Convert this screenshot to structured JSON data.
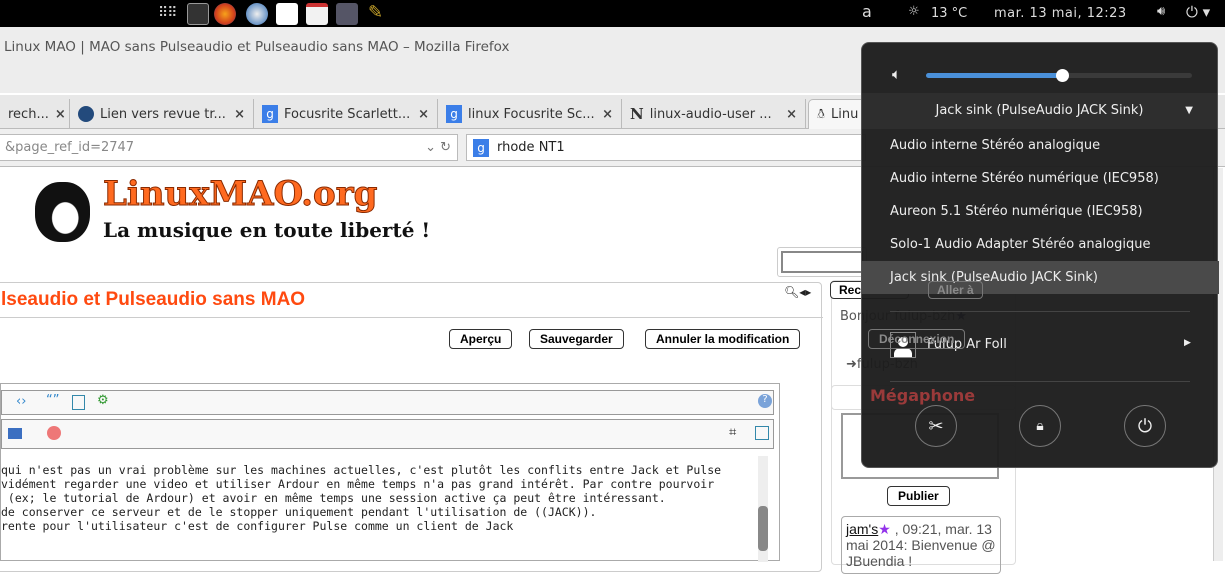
{
  "topbar": {
    "weather": "13 °C",
    "clock": "mar. 13 mai, 12:23",
    "accessibility_glyph": "a"
  },
  "window": {
    "title": "Linux MAO | MAO sans Pulseaudio et Pulseaudio sans MAO – Mozilla Firefox"
  },
  "tabs": [
    {
      "label": "rech...",
      "icon": "tab-icon"
    },
    {
      "label": "Lien vers revue tr...",
      "icon": "wave-icon"
    },
    {
      "label": "Focusrite Scarlett...",
      "icon": "google-icon"
    },
    {
      "label": "linux Focusrite Sc...",
      "icon": "google-icon"
    },
    {
      "label": "linux-audio-user ...",
      "icon": "n-icon"
    },
    {
      "label": "Linu",
      "icon": "tux-icon"
    }
  ],
  "tab_close": "×",
  "navbar": {
    "url": "&page_ref_id=2747",
    "search": "rhode NT1",
    "google_glyph": "g"
  },
  "site": {
    "logo_title": "LinuxMAO.org",
    "logo_tagline": "La musique en toute liberté !",
    "page_heading": "lseaudio et Pulseaudio sans MAO",
    "buttons": {
      "preview": "Aperçu",
      "save": "Sauvegarder",
      "cancel": "Annuler la modification"
    },
    "editor_lines": [
      "qui n'est pas un vrai problème sur les machines actuelles, c'est plutôt les conflits entre Jack et Pulse",
      "vidément regarder une video et utiliser Ardour en même temps n'a pas grand intérêt. Par contre pourvoir",
      " (ex; le tutorial de Ardour) et avoir en même temps une session active ça peut être intéressant.",
      "",
      "de conserver ce serveur et de le stopper uniquement pendant l'utilisation de ((JACK)).",
      "rente pour l'utilisateur c'est de configurer Pulse comme un client de Jack"
    ],
    "sidebar": {
      "search_btn": "Recherche",
      "goto_btn": "Aller à",
      "greeting": "Bonjour fulup-bzh",
      "logout": "Déconnexion",
      "user": "fulup-bzh",
      "megaphone": "Mégaphone",
      "publish": "Publier",
      "msg_user": "jam's",
      "msg_text": ", 09:21, mar. 13 mai 2014: Bienvenue @ JBuendia !"
    }
  },
  "popup": {
    "volume_percent": 51,
    "selected_sink": "Jack sink (PulseAudio JACK Sink)",
    "sinks": [
      "Audio interne Stéréo analogique",
      "Audio interne Stéréo numérique (IEC958)",
      "Aureon 5.1 Stéréo numérique (IEC958)",
      "Solo-1 Audio Adapter Stéréo analogique",
      "Jack sink (PulseAudio JACK Sink)"
    ],
    "active_index": 4,
    "user_name": "Fulup Ar Foll"
  },
  "colors": {
    "accent": "#4a90d9",
    "site_orange": "#ff5a14"
  }
}
